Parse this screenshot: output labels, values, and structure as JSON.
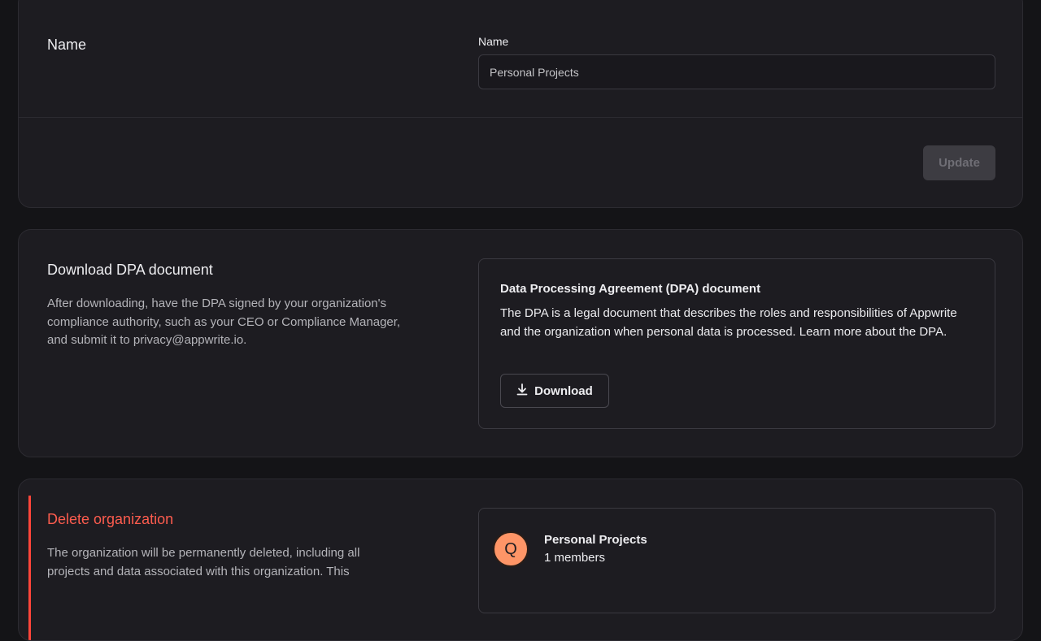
{
  "name_section": {
    "title": "Name",
    "field_label": "Name",
    "field_value": "Personal Projects",
    "update_label": "Update"
  },
  "dpa_section": {
    "title": "Download DPA document",
    "description": "After downloading, have the DPA signed by your organization's compliance authority, such as your CEO or Compliance Manager, and submit it to privacy@appwrite.io.",
    "box_title": "Data Processing Agreement (DPA) document",
    "box_text": "The DPA is a legal document that describes the roles and responsibilities of Appwrite and the organization when personal data is processed. Learn more about the DPA.",
    "download_label": "Download",
    "download_icon": "download-icon"
  },
  "delete_section": {
    "title": "Delete organization",
    "description": "The organization will be permanently deleted, including all projects and data associated with this organization. This",
    "org": {
      "avatar_letter": "Q",
      "name": "Personal Projects",
      "members": "1 members"
    }
  },
  "colors": {
    "background": "#141417",
    "card": "#1d1c21",
    "danger": "#fd5c4e",
    "avatar": "#fe9567"
  }
}
